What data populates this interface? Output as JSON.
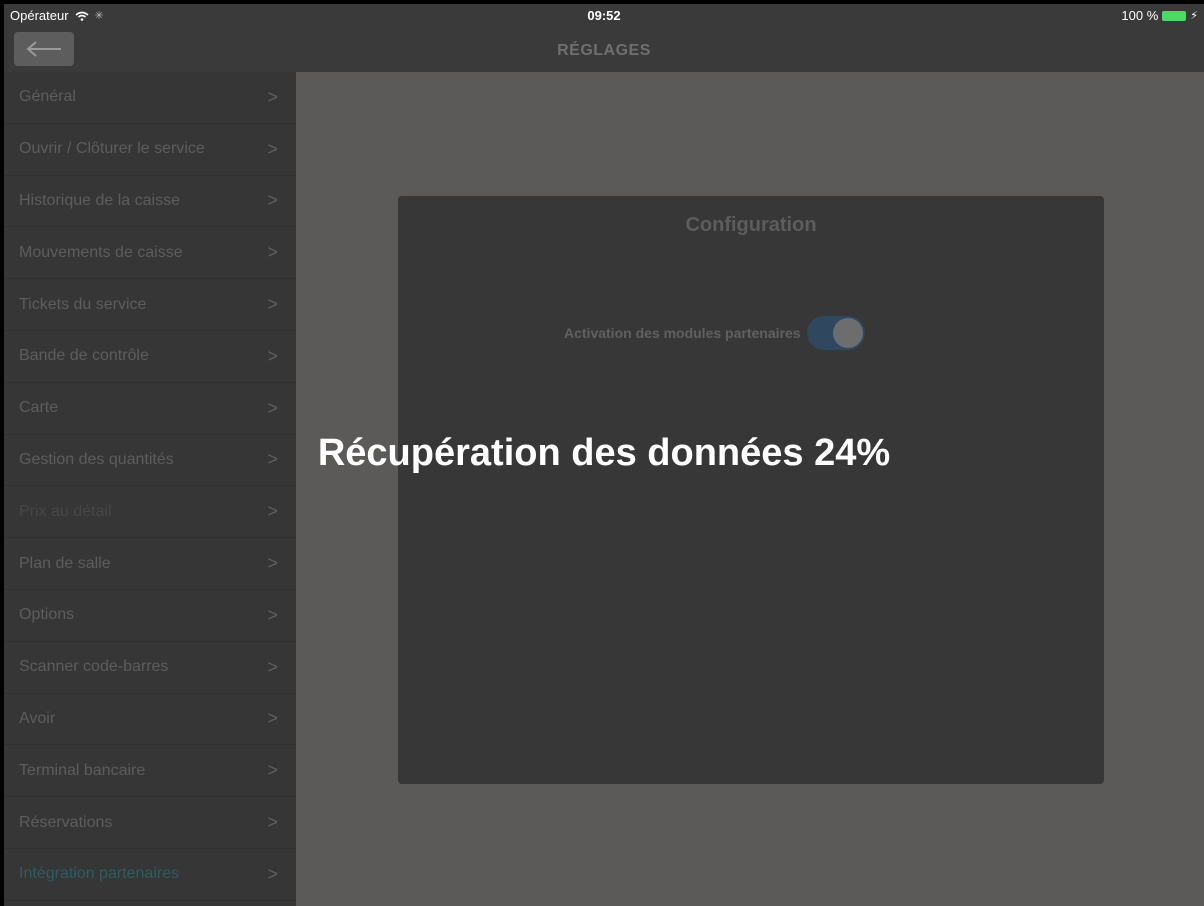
{
  "status_bar": {
    "carrier": "Opérateur",
    "time": "09:52",
    "battery": "100 %"
  },
  "nav": {
    "title": "RÉGLAGES",
    "back_icon": "arrow-left-icon"
  },
  "sidebar": {
    "items": [
      {
        "label": "Général"
      },
      {
        "label": "Ouvrir / Clôturer le service"
      },
      {
        "label": "Historique de la caisse"
      },
      {
        "label": "Mouvements de caisse"
      },
      {
        "label": "Tickets du service"
      },
      {
        "label": "Bande de contrôle"
      },
      {
        "label": "Carte"
      },
      {
        "label": "Gestion des quantités"
      },
      {
        "label": "Prix au détail"
      },
      {
        "label": "Plan de salle"
      },
      {
        "label": "Options"
      },
      {
        "label": "Scanner code-barres"
      },
      {
        "label": "Avoir"
      },
      {
        "label": "Terminal bancaire"
      },
      {
        "label": "Réservations"
      },
      {
        "label": "Intégration partenaires"
      }
    ],
    "chevron": ">"
  },
  "panel": {
    "title": "Configuration",
    "toggle_label": "Activation des modules partenaires",
    "toggle_on": true
  },
  "overlay": {
    "message": "Récupération des données 24%"
  },
  "colors": {
    "active_item": "#2f5b63",
    "battery": "#4cd964",
    "toggle_track": "#2f4860"
  }
}
